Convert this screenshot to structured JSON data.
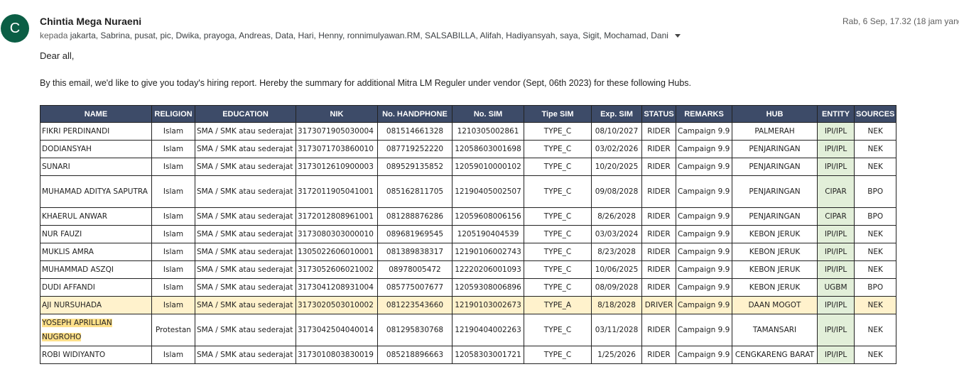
{
  "email": {
    "avatar_letter": "C",
    "sender": "Chintia Mega Nuraeni",
    "recipients_prefix": "kepada",
    "recipients": "jakarta, Sabrina, pusat, pic, Dwika, prayoga, Andreas, Data, Hari, Henny, ronnimulyawan.RM, SALSABILLA, Alifah, Hadiyansyah, saya, Sigit, Mochamad, Dani",
    "date": "Rab, 6 Sep, 17.32 (18 jam yang",
    "greeting": "Dear all,",
    "intro": "By this email, we'd like to give you today's hiring report. Hereby the summary for additional Mitra LM Reguler under vendor (Sept, 06th 2023) for these following Hubs."
  },
  "table": {
    "headers": [
      "NAME",
      "RELIGION",
      "EDUCATION",
      "NIK",
      "No. HANDPHONE",
      "No. SIM",
      "Tipe SIM",
      "Exp. SIM",
      "STATUS",
      "REMARKS",
      "HUB",
      "ENTITY",
      "SOURCES"
    ],
    "rows": [
      [
        "FIKRI PERDINANDI",
        "Islam",
        "SMA / SMK atau sederajat",
        "3173071905030004",
        "081514661328",
        "1210305002861",
        "TYPE_C",
        "08/10/2027",
        "RIDER",
        "Campaign 9.9",
        "PALMERAH",
        "IPI/IPL",
        "NEK"
      ],
      [
        "DODIANSYAH",
        "Islam",
        "SMA / SMK atau sederajat",
        "3173071703860010",
        "087719252220",
        "12058603001698",
        "TYPE_C",
        "03/02/2026",
        "RIDER",
        "Campaign 9.9",
        "PENJARINGAN",
        "IPI/IPL",
        "NEK"
      ],
      [
        "SUNARI",
        "Islam",
        "SMA / SMK atau sederajat",
        "3173012610900003",
        "089529135852",
        "12059010000102",
        "TYPE_C",
        "10/20/2025",
        "RIDER",
        "Campaign 9.9",
        "PENJARINGAN",
        "IPI/IPL",
        "NEK"
      ],
      [
        "MUHAMAD ADITYA SAPUTRA",
        "Islam",
        "SMA / SMK atau sederajat",
        "3172011905041001",
        "085162811705",
        "12190405002507",
        "TYPE_C",
        "09/08/2028",
        "RIDER",
        "Campaign 9.9",
        "PENJARINGAN",
        "CIPAR",
        "BPO"
      ],
      [
        "KHAERUL ANWAR",
        "Islam",
        "SMA / SMK atau sederajat",
        "3172012808961001",
        "081288876286",
        "12059608006156",
        "TYPE_C",
        "8/26/2028",
        "RIDER",
        "Campaign 9.9",
        "PENJARINGAN",
        "CIPAR",
        "BPO"
      ],
      [
        "NUR FAUZI",
        "Islam",
        "SMA / SMK atau sederajat",
        "3173080303000010",
        "089681969545",
        "1205190404539",
        "TYPE_C",
        "03/03/2024",
        "RIDER",
        "Campaign 9.9",
        "KEBON JERUK",
        "IPI/IPL",
        "NEK"
      ],
      [
        "MUKLIS AMRA",
        "Islam",
        "SMA / SMK atau sederajat",
        "1305022606010001",
        "081389838317",
        "12190106002743",
        "TYPE_C",
        "8/23/2028",
        "RIDER",
        "Campaign 9.9",
        "KEBON JERUK",
        "IPI/IPL",
        "NEK"
      ],
      [
        "MUHAMMAD ASZQI",
        "Islam",
        "SMA / SMK atau sederajat",
        "3173052606021002",
        "08978005472",
        "12220206001093",
        "TYPE_C",
        "10/06/2025",
        "RIDER",
        "Campaign 9.9",
        "KEBON JERUK",
        "IPI/IPL",
        "NEK"
      ],
      [
        "DUDI AFFANDI",
        "Islam",
        "SMA / SMK atau sederajat",
        "3173041208931004",
        "085775007677",
        "12059308006896",
        "TYPE_C",
        "08/09/2028",
        "RIDER",
        "Campaign 9.9",
        "KEBON JERUK",
        "UGBM",
        "BPO"
      ],
      [
        "AJI NURSUHADA",
        "Islam",
        "SMA / SMK atau sederajat",
        "3173020503010002",
        "081223543660",
        "12190103002673",
        "TYPE_A",
        "8/18/2028",
        "DRIVER",
        "Campaign 9.9",
        "DAAN MOGOT",
        "IPI/IPL",
        "NEK"
      ],
      [
        "YOSEPH APRILLIAN NUGROHO",
        "Protestan",
        "SMA / SMK atau sederajat",
        "3173042504040014",
        "081295830768",
        "12190404002263",
        "TYPE_C",
        "03/11/2028",
        "RIDER",
        "Campaign 9.9",
        "TAMANSARI",
        "IPI/IPL",
        "NEK"
      ],
      [
        "ROBI WIDIYANTO",
        "Islam",
        "SMA / SMK atau sederajat",
        "3173010803830019",
        "085218896663",
        "12058303001721",
        "TYPE_C",
        "1/25/2026",
        "RIDER",
        "Campaign 9.9",
        "CENGKARENG BARAT",
        "IPI/IPL",
        "NEK"
      ]
    ],
    "highlighted_row": 9,
    "tall_rows": [
      3,
      10
    ],
    "marked_row": 10
  },
  "colors": {
    "avatar": "#0b5e45",
    "header_bg": "#3d4b68",
    "entity_bg": "#e2efd9",
    "highlight_row": "#fff2cc",
    "text_mark": "#ffe08a"
  }
}
